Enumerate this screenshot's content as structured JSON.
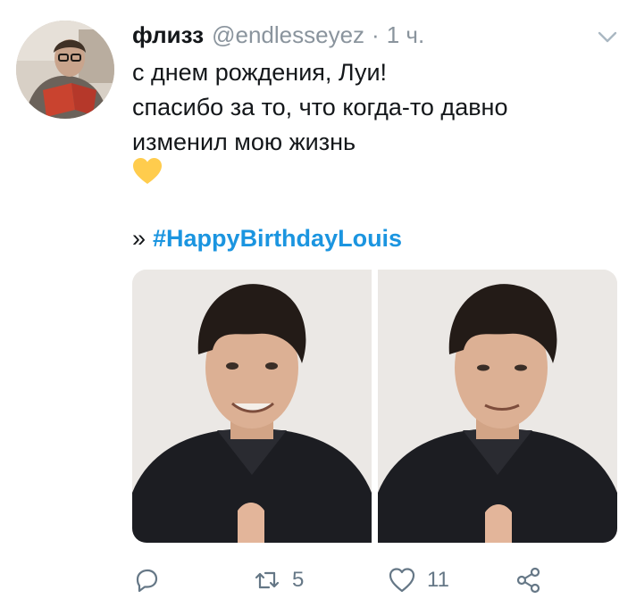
{
  "tweet": {
    "author": {
      "display_name": "флизз",
      "handle": "@endlesseyez",
      "separator": "·",
      "time": "1 ч."
    },
    "text_lines": [
      "с днем рождения, Луи!",
      "спасибо за то, что когда-то давно",
      "изменил мою жизнь"
    ],
    "emoji": "yellow-heart",
    "hashtag_prefix": "»",
    "hashtag": "#HappyBirthdayLouis",
    "media_count": 2,
    "actions": {
      "reply_count": "",
      "retweet_count": "5",
      "like_count": "11"
    }
  },
  "colors": {
    "link": "#1b95e0",
    "muted": "#8a949d",
    "icon": "#657786",
    "text": "#14171a",
    "emoji_heart": "#ffcc4d"
  }
}
